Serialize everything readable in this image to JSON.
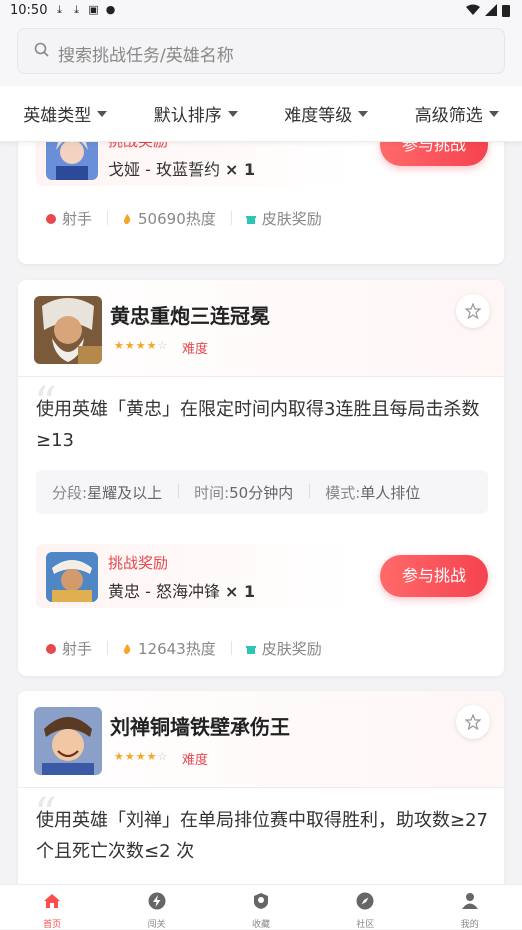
{
  "status_bar": {
    "time": "10:50"
  },
  "search": {
    "placeholder": "搜索挑战任务/英雄名称"
  },
  "filters": [
    "英雄类型",
    "默认排序",
    "难度等级",
    "高级筛选"
  ],
  "cards": [
    {
      "reward": {
        "label": "挑战奖励",
        "item": "戈娅 - 玫蓝誓约",
        "qty": "× 1"
      },
      "button": "参与挑战",
      "tags": {
        "role": "射手",
        "heat": "50690热度",
        "reward": "皮肤奖励"
      }
    },
    {
      "title": "黄忠重炮三连冠冕",
      "stars_filled": 4,
      "stars_total": 5,
      "difficulty_label": "难度",
      "description": "使用英雄「黄忠」在限定时间内取得3连胜且每局击杀数≥13",
      "meta": {
        "rank_label": "分段:",
        "rank_value": "星耀及以上",
        "time_label": "时间:",
        "time_value": "50分钟内",
        "mode_label": "模式:",
        "mode_value": "单人排位"
      },
      "reward": {
        "label": "挑战奖励",
        "item": "黄忠 - 怒海冲锋",
        "qty": "× 1"
      },
      "button": "参与挑战",
      "tags": {
        "role": "射手",
        "heat": "12643热度",
        "reward": "皮肤奖励"
      }
    },
    {
      "title": "刘禅铜墙铁壁承伤王",
      "stars_filled": 4,
      "stars_total": 5,
      "difficulty_label": "难度",
      "description": "使用英雄「刘禅」在单局排位赛中取得胜利，助攻数≥27 个且死亡次数≤2 次"
    }
  ],
  "tabbar": [
    {
      "label": "首页",
      "icon": "home-icon",
      "active": true
    },
    {
      "label": "闯关",
      "icon": "lightning-icon",
      "active": false
    },
    {
      "label": "收藏",
      "icon": "bookmark-icon",
      "active": false
    },
    {
      "label": "社区",
      "icon": "compass-icon",
      "active": false
    },
    {
      "label": "我的",
      "icon": "user-icon",
      "active": false
    }
  ],
  "colors": {
    "accent": "#f5424f",
    "star": "#f5a623",
    "difficulty": "#e5484d"
  }
}
